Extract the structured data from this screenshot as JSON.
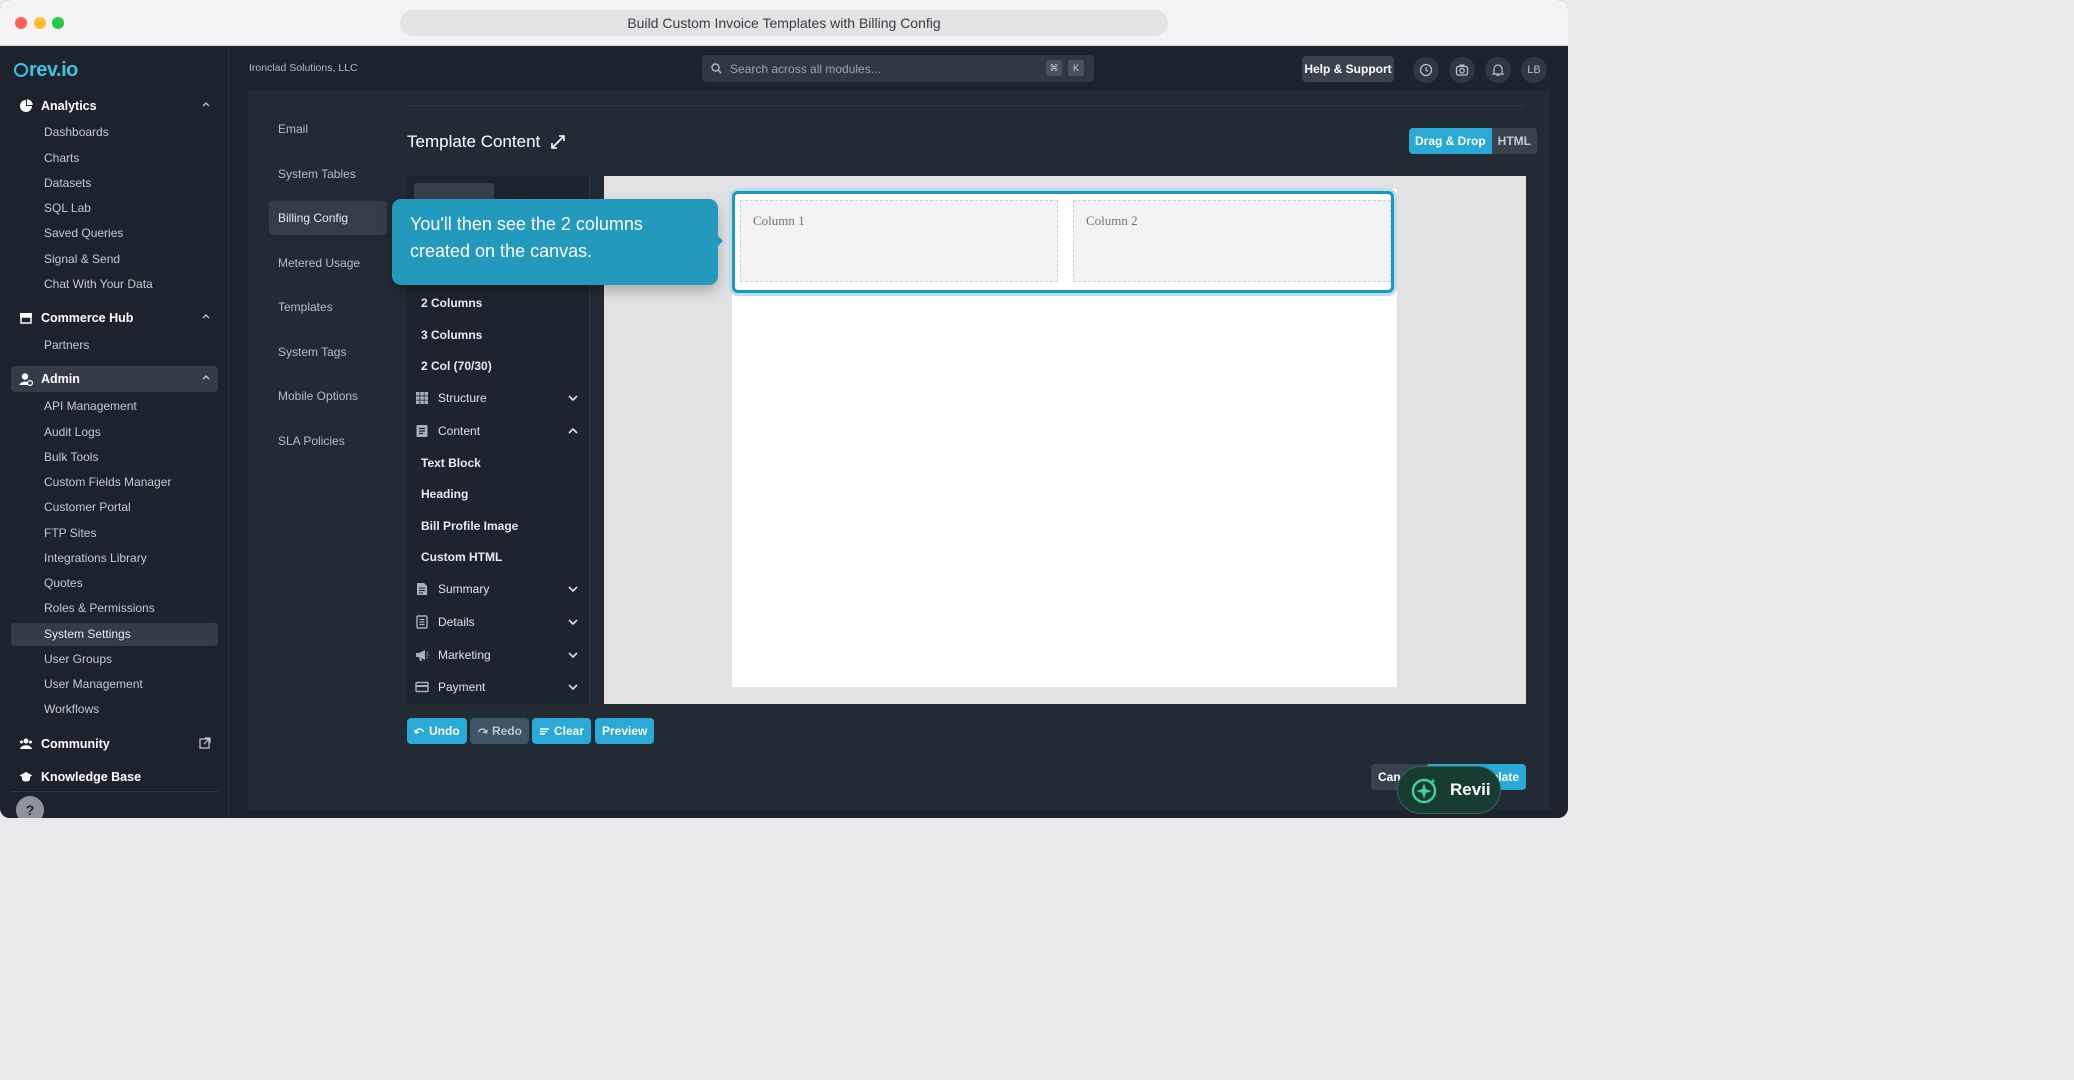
{
  "window": {
    "title": "Build Custom Invoice Templates with Billing Config"
  },
  "sidebar": {
    "logo": "rev.io",
    "sections": [
      {
        "label": "Analytics",
        "items": [
          "Dashboards",
          "Charts",
          "Datasets",
          "SQL Lab",
          "Saved Queries",
          "Signal & Send",
          "Chat With Your Data"
        ]
      },
      {
        "label": "Commerce Hub",
        "items": [
          "Partners"
        ]
      },
      {
        "label": "Admin",
        "items": [
          "API Management",
          "Audit Logs",
          "Bulk Tools",
          "Custom Fields Manager",
          "Customer Portal",
          "FTP Sites",
          "Integrations Library",
          "Quotes",
          "Roles & Permissions",
          "System Settings",
          "User Groups",
          "User Management",
          "Workflows"
        ]
      }
    ],
    "community": "Community",
    "knowledge_base": "Knowledge Base",
    "help_glyph": "?"
  },
  "topbar": {
    "company": "Ironclad Solutions, LLC",
    "search_placeholder": "Search across all modules...",
    "shortcut_keys": [
      "⌘",
      "K"
    ],
    "help_label": "Help & Support",
    "avatar_initials": "LB"
  },
  "subnav": [
    "Email",
    "System Tables",
    "Billing Config",
    "Metered Usage",
    "Templates",
    "System Tags",
    "Mobile Options",
    "SLA Policies"
  ],
  "editor": {
    "title": "Template Content",
    "mode_options": [
      "Drag & Drop",
      "HTML"
    ],
    "layout_items": [
      "2 Columns",
      "3 Columns",
      "2 Col (70/30)"
    ],
    "groups": [
      {
        "label": "Structure",
        "icon": "grid-icon",
        "expanded": false
      },
      {
        "label": "Content",
        "icon": "document-icon",
        "expanded": true
      }
    ],
    "content_items": [
      "Text Block",
      "Heading",
      "Bill Profile Image",
      "Custom HTML"
    ],
    "more_groups": [
      {
        "label": "Summary",
        "icon": "summary-icon"
      },
      {
        "label": "Details",
        "icon": "details-icon"
      },
      {
        "label": "Marketing",
        "icon": "megaphone-icon"
      },
      {
        "label": "Payment",
        "icon": "card-icon"
      }
    ],
    "canvas_columns": [
      "Column 1",
      "Column 2"
    ],
    "actions": {
      "undo": "Undo",
      "redo": "Redo",
      "clear": "Clear",
      "preview": "Preview"
    },
    "cancel_partial": "Can",
    "save_partial": "plate"
  },
  "callout": {
    "text": "You'll then see the 2 columns created on the canvas."
  },
  "assistant": {
    "label": "Revii"
  },
  "colors": {
    "accent": "#29a9d6",
    "background": "#1c232c",
    "callout": "#2399bd"
  }
}
